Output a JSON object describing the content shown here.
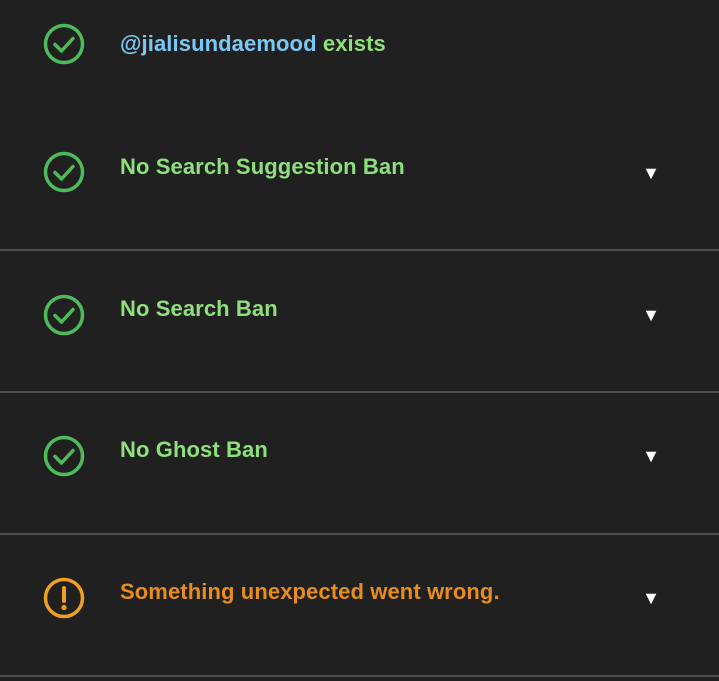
{
  "colors": {
    "background": "#202020",
    "success": "#4cbc5a",
    "success_text": "#8ee07c",
    "username": "#7cc8f5",
    "warning": "#f0a020",
    "warning_text": "#e68d1e",
    "divider": "#4a4f52"
  },
  "results": [
    {
      "status": "success",
      "icon": "check-circle-icon",
      "username": "@jialisundaemood",
      "text": "exists"
    },
    {
      "status": "success",
      "icon": "check-circle-icon",
      "text": "No Search Suggestion Ban",
      "toggle": "▼"
    },
    {
      "status": "success",
      "icon": "check-circle-icon",
      "text": "No Search Ban",
      "toggle": "▼"
    },
    {
      "status": "success",
      "icon": "check-circle-icon",
      "text": "No Ghost Ban",
      "toggle": "▼"
    },
    {
      "status": "warning",
      "icon": "exclamation-circle-icon",
      "text": "Something unexpected went wrong.",
      "toggle": "▼"
    }
  ]
}
